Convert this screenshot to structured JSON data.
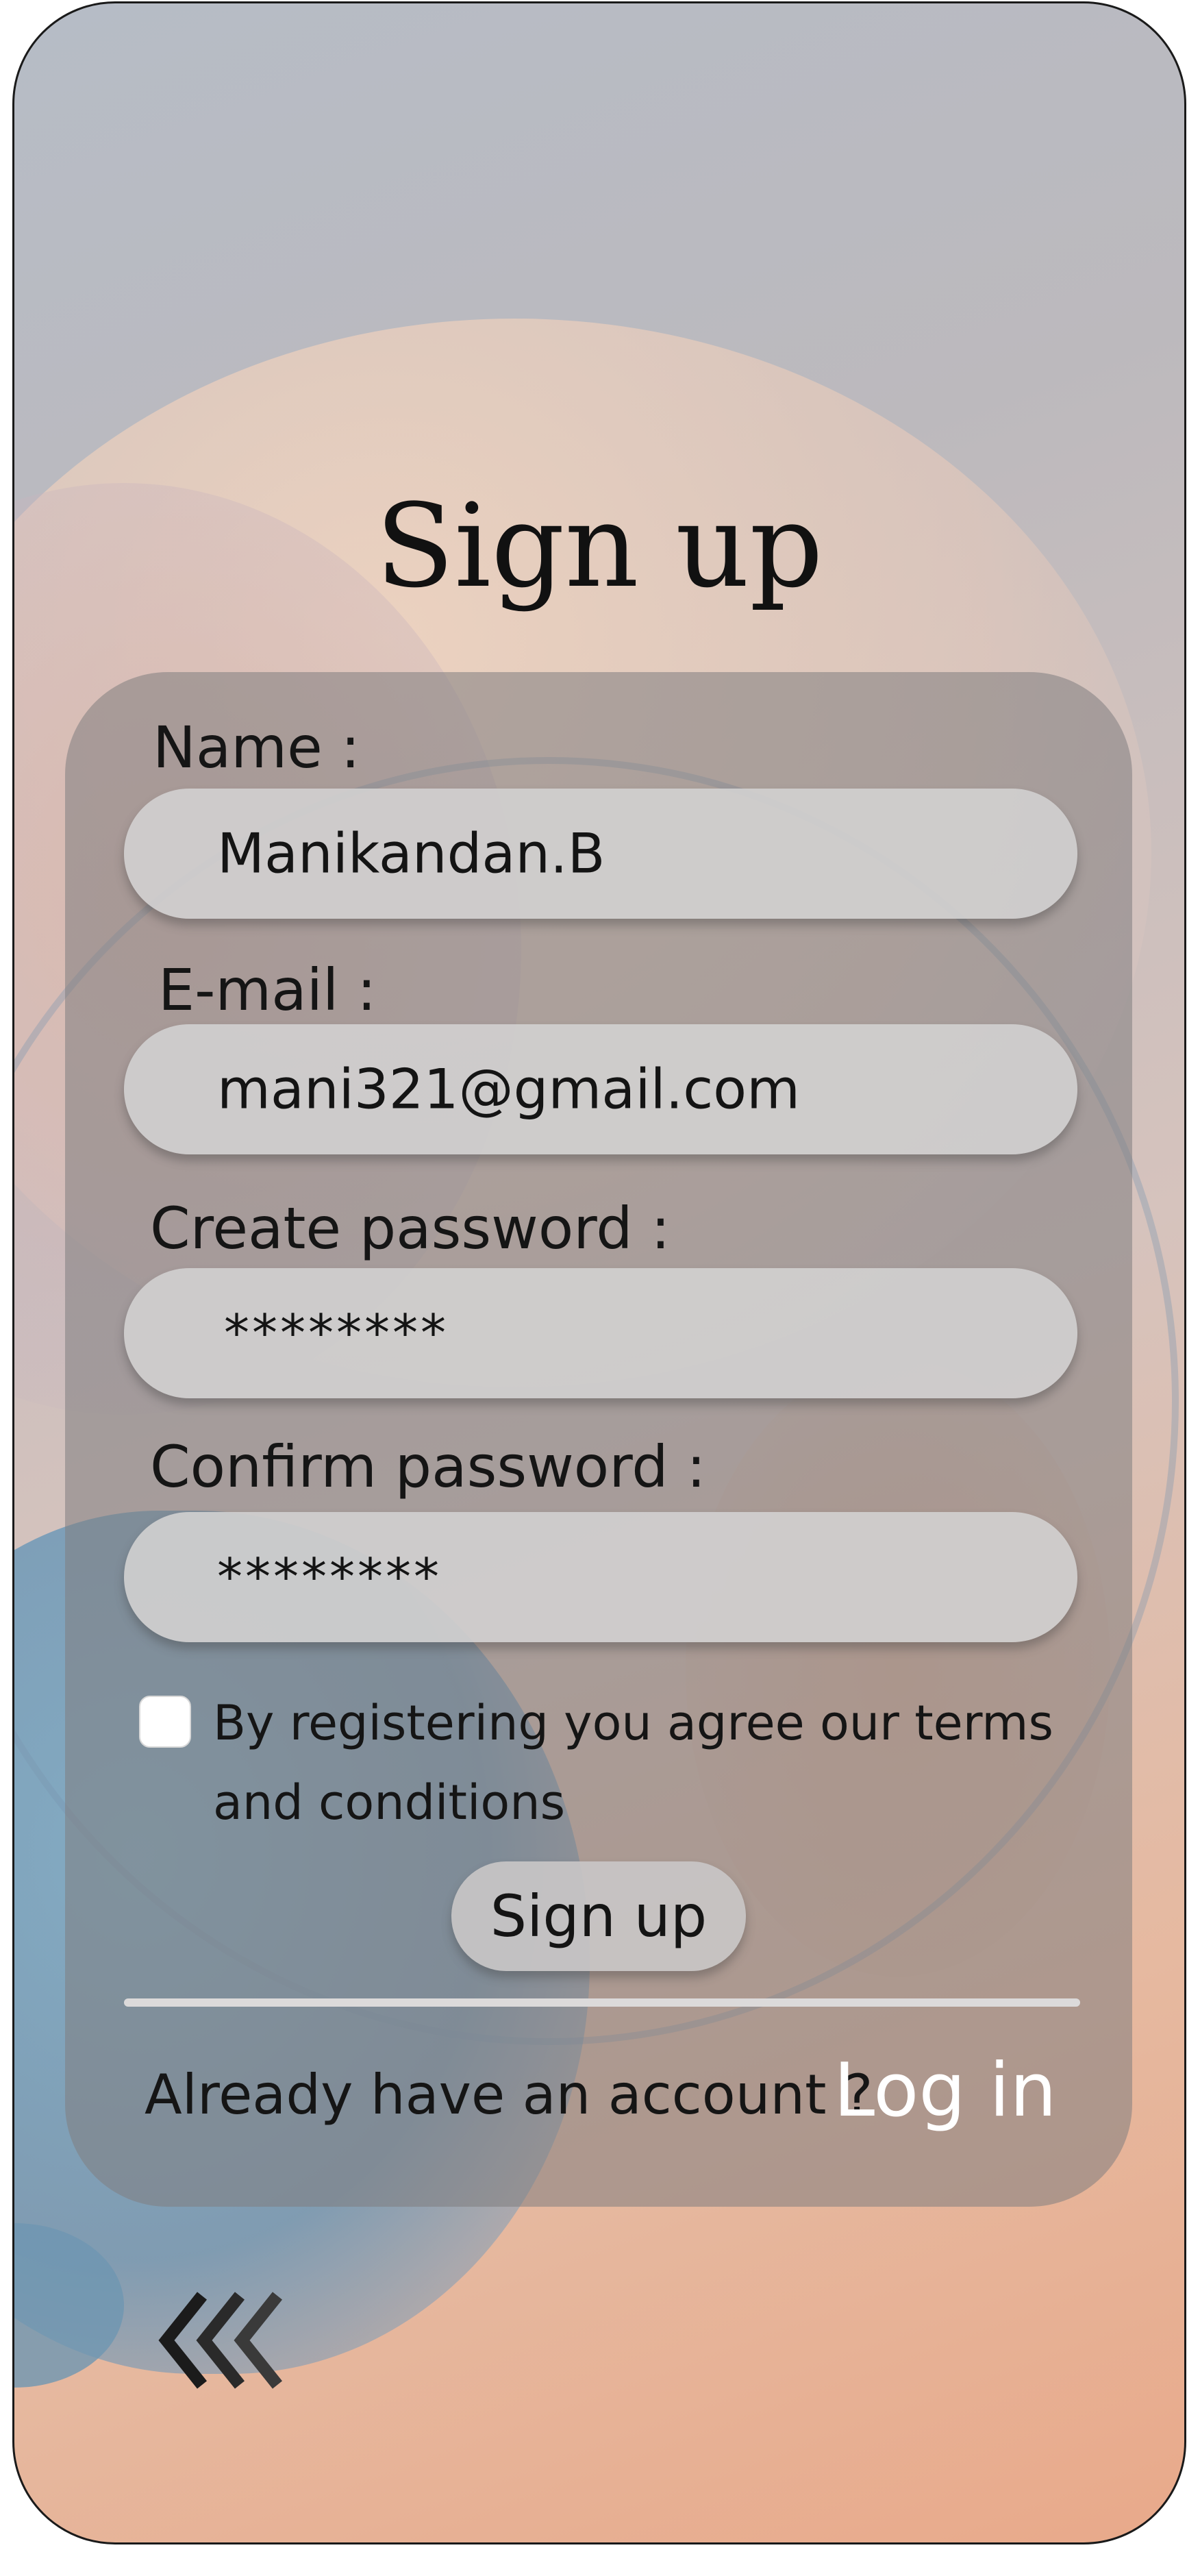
{
  "page": {
    "title": "Sign up"
  },
  "form": {
    "name": {
      "label": "Name :",
      "value": "Manikandan.B"
    },
    "email": {
      "label": "E-mail :",
      "value": "mani321@gmail.com"
    },
    "create_password": {
      "label": "Create password :",
      "value": "********"
    },
    "confirm_password": {
      "label": "Confirm password :",
      "value": "********"
    },
    "terms": {
      "checked": false,
      "text": "By registering you agree our terms and conditions"
    },
    "submit_label": "Sign up"
  },
  "footer": {
    "prompt": "Already have an account ?",
    "login_label": "Log in"
  },
  "icons": {
    "back": "triple-chevron-left-icon"
  },
  "colors": {
    "login_link": "#ffffff",
    "card": "#807e80",
    "field": "#d2d0d0"
  }
}
